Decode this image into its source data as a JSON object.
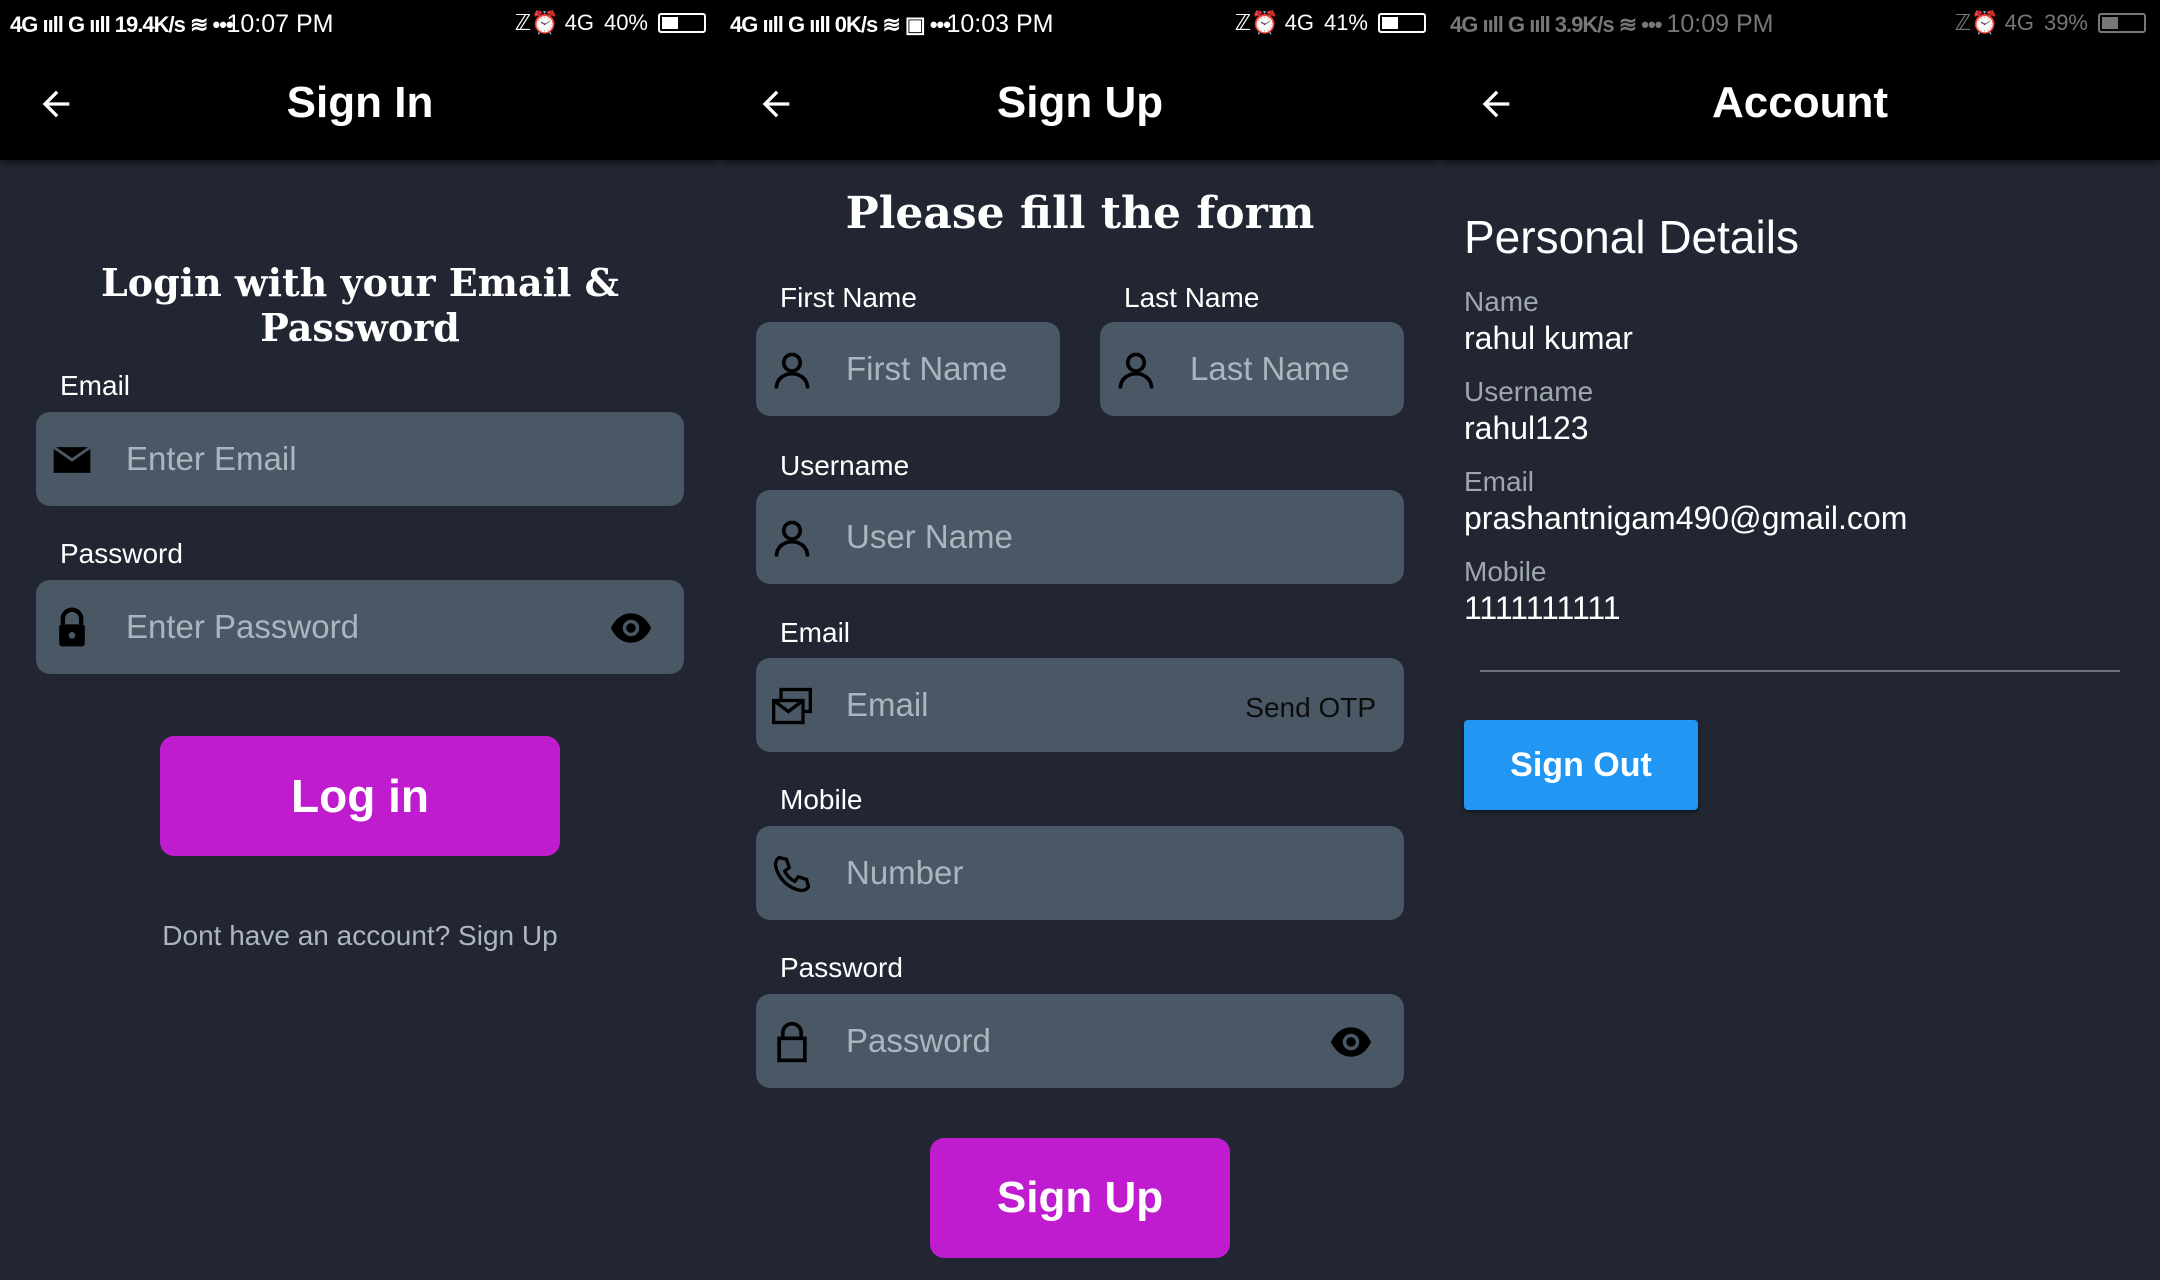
{
  "screens": {
    "signin": {
      "status": {
        "left": "4G ııll G ııll 19.4K/s ≋ •••",
        "time": "10:07 PM",
        "right_icons": "ℤ⏰ 4G",
        "battery": "40%",
        "battery_level": 0.4
      },
      "appbar": {
        "title": "Sign In"
      },
      "heading": "Login with your Email & Password",
      "email_label": "Email",
      "email_placeholder": "Enter Email",
      "password_label": "Password",
      "password_placeholder": "Enter Password",
      "login_button": "Log in",
      "signup_link": "Dont have an account? Sign Up"
    },
    "signup": {
      "status": {
        "left": "4G ııll G ııll 0K/s ≋ ▣ •••",
        "time": "10:03 PM",
        "right_icons": "ℤ⏰ 4G",
        "battery": "41%",
        "battery_level": 0.41
      },
      "appbar": {
        "title": "Sign Up"
      },
      "heading": "Please fill the form",
      "first_name_label": "First Name",
      "first_name_placeholder": "First Name",
      "last_name_label": "Last Name",
      "last_name_placeholder": "Last Name",
      "username_label": "Username",
      "username_placeholder": "User Name",
      "email_label": "Email",
      "email_placeholder": "Email",
      "send_otp": "Send OTP",
      "mobile_label": "Mobile",
      "mobile_placeholder": "Number",
      "password_label": "Password",
      "password_placeholder": "Password",
      "signup_button": "Sign Up"
    },
    "account": {
      "status": {
        "left": "4G ııll G ııll 3.9K/s ≋ •••",
        "time": "10:09 PM",
        "right_icons": "ℤ⏰ 4G",
        "battery": "39%",
        "battery_level": 0.39
      },
      "appbar": {
        "title": "Account"
      },
      "section_title": "Personal Details",
      "name_label": "Name",
      "name_value": "rahul kumar",
      "username_label": "Username",
      "username_value": "rahul123",
      "email_label": "Email",
      "email_value": "prashantnigam490@gmail.com",
      "mobile_label": "Mobile",
      "mobile_value": "1111111111",
      "signout_button": "Sign Out"
    }
  },
  "colors": {
    "background": "#222632",
    "appbar": "#000000",
    "field": "#4a5866",
    "primary_purple": "#c01ccf",
    "signout_blue": "#2196f3"
  }
}
